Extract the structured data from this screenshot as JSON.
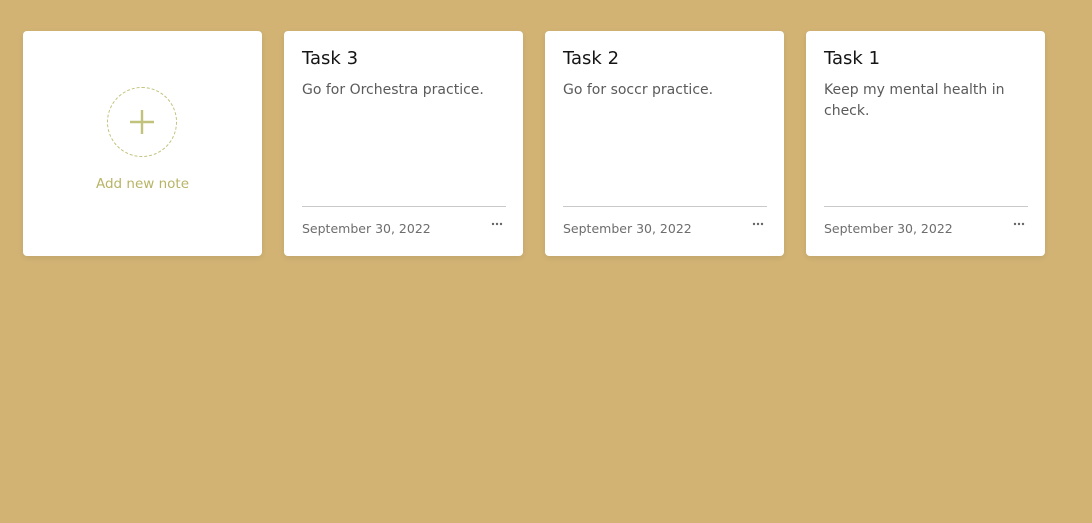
{
  "colors": {
    "background": "#d2b374",
    "card": "#ffffff",
    "accent": "#b8b466"
  },
  "add_note": {
    "icon": "plus-icon",
    "label": "Add new note"
  },
  "notes": [
    {
      "title": "Task 3",
      "description": "Go for Orchestra practice.",
      "date": "September 30, 2022",
      "menu_icon": "more-horizontal-icon"
    },
    {
      "title": "Task 2",
      "description": "Go for soccr practice.",
      "date": "September 30, 2022",
      "menu_icon": "more-horizontal-icon"
    },
    {
      "title": "Task 1",
      "description": "Keep my mental health in check.",
      "date": "September 30, 2022",
      "menu_icon": "more-horizontal-icon"
    }
  ]
}
